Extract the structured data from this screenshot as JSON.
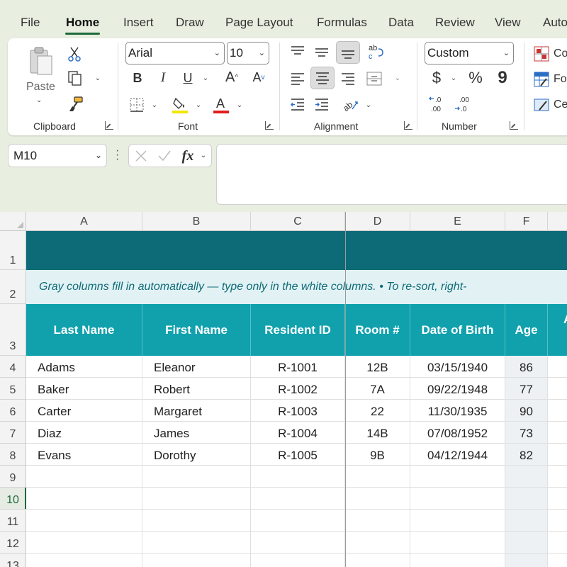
{
  "tabs": [
    "File",
    "Home",
    "Insert",
    "Draw",
    "Page Layout",
    "Formulas",
    "Data",
    "Review",
    "View",
    "Auto"
  ],
  "ribbon": {
    "clipboard": {
      "label": "Clipboard",
      "paste_label": "Paste"
    },
    "font": {
      "label": "Font",
      "font_name": "Arial",
      "font_size": "10",
      "bold": "B",
      "italic": "I",
      "underline": "U",
      "grow": "A",
      "shrink": "A",
      "font_color_accent": "#e11d1d",
      "highlight_accent": "#f5e400"
    },
    "alignment": {
      "label": "Alignment"
    },
    "number": {
      "label": "Number",
      "format": "Custom",
      "currency": "$",
      "percent": "%",
      "comma": "9"
    },
    "styles": {
      "items": [
        "Co",
        "Fo",
        "Ce"
      ]
    }
  },
  "formula_bar": {
    "name_box": "M10",
    "fx": "fx",
    "value": ""
  },
  "sheet": {
    "columns": [
      "A",
      "B",
      "C",
      "D",
      "E",
      "F"
    ],
    "rows": [
      "1",
      "2",
      "3",
      "4",
      "5",
      "6",
      "7",
      "8",
      "9",
      "10",
      "11",
      "12",
      "13"
    ],
    "active_row": "10",
    "note": "Gray columns fill in automatically — type only in the white columns.   •   To re-sort, right-",
    "headers": [
      "Last Name",
      "First Name",
      "Resident ID",
      "Room #",
      "Date of Birth",
      "Age",
      "A"
    ],
    "data": [
      [
        "Adams",
        "Eleanor",
        "R-1001",
        "12B",
        "03/15/1940",
        "86"
      ],
      [
        "Baker",
        "Robert",
        "R-1002",
        "7A",
        "09/22/1948",
        "77"
      ],
      [
        "Carter",
        "Margaret",
        "R-1003",
        "22",
        "11/30/1935",
        "90"
      ],
      [
        "Diaz",
        "James",
        "R-1004",
        "14B",
        "07/08/1952",
        "73"
      ],
      [
        "Evans",
        "Dorothy",
        "R-1005",
        "9B",
        "04/12/1944",
        "82"
      ]
    ],
    "colors": {
      "banner": "#0d6b78",
      "header": "#10a1ad",
      "note_bg": "#e2f2f4",
      "note_text": "#0d6b78",
      "computed_col": "#edf1f3",
      "accent": "#1d6b3a"
    }
  }
}
